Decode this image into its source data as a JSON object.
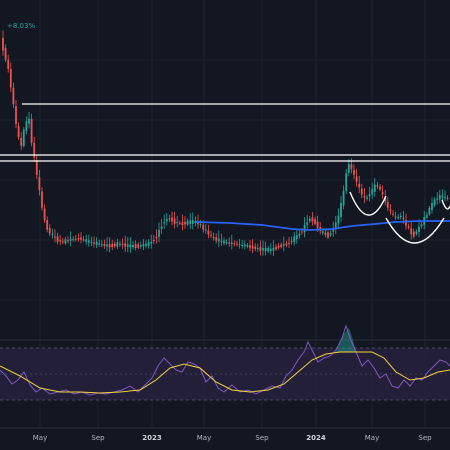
{
  "chart_data": {
    "type": "candlestick",
    "price_change_label": "+8.03%",
    "x_ticks": [
      "May",
      "Sep",
      "2023",
      "May",
      "Sep",
      "2024",
      "May",
      "Sep"
    ],
    "x_ticks_bold": [
      false,
      false,
      true,
      false,
      false,
      true,
      false,
      false
    ],
    "colors": {
      "background": "#131722",
      "up": "#26a69a",
      "down": "#ef5350",
      "moving_average": "#2962ff",
      "resistance": "#ffffff",
      "oscillator_line": "#7e57c2",
      "oscillator_signal": "#f2d33a",
      "oscillator_band": "#2a2340"
    }
  }
}
